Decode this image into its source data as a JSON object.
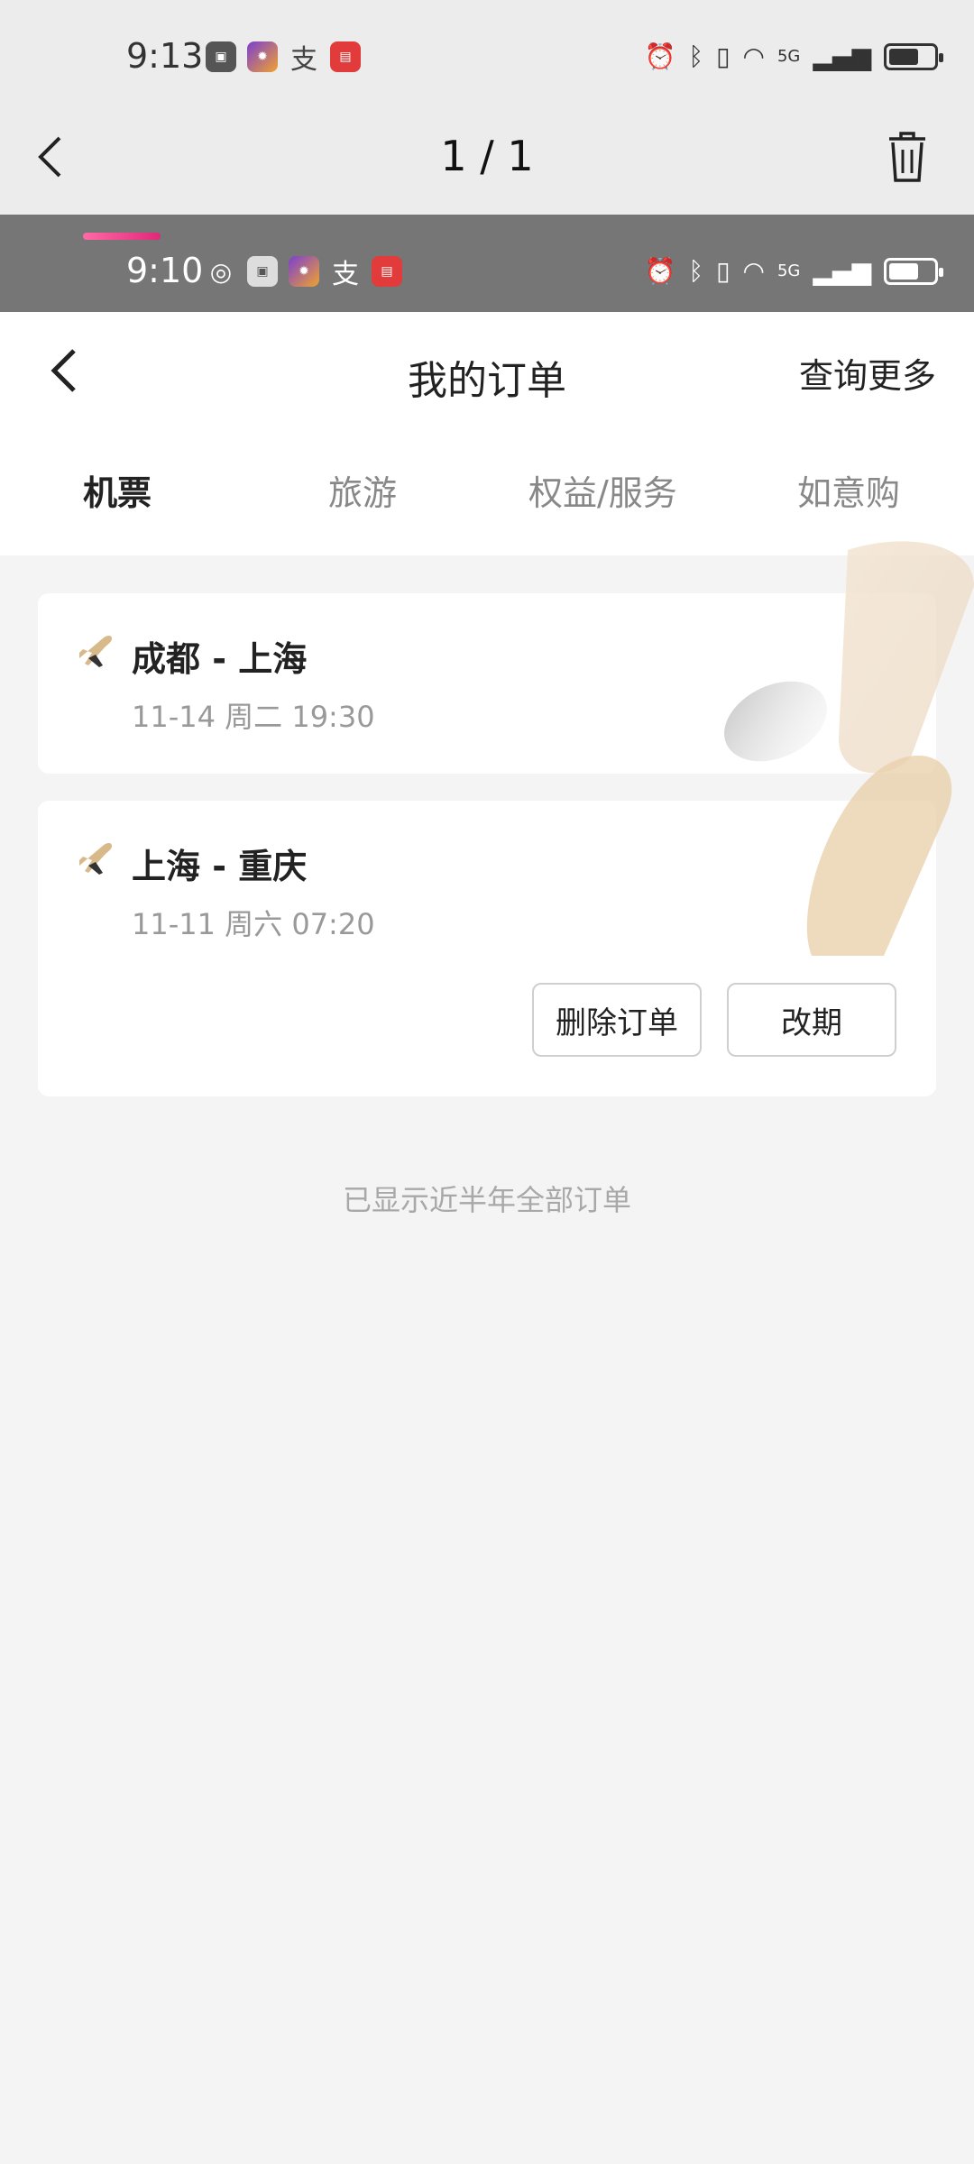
{
  "outer_status": {
    "time": "9:13",
    "network": "5G"
  },
  "viewer": {
    "back_glyph": "‹",
    "counter": "1 / 1"
  },
  "shot_status": {
    "time": "9:10",
    "network": "5G"
  },
  "header": {
    "back_glyph": "‹",
    "title": "我的订单",
    "more": "查询更多"
  },
  "tabs": [
    {
      "label": "机票",
      "active": true
    },
    {
      "label": "旅游",
      "active": false
    },
    {
      "label": "权益/服务",
      "active": false
    },
    {
      "label": "如意购",
      "active": false
    }
  ],
  "orders": [
    {
      "route": "成都 - 上海",
      "date": "11-14 周二 19:30"
    },
    {
      "route": "上海 - 重庆",
      "date": "11-11 周六 07:20",
      "buttons": [
        "删除订单",
        "改期"
      ]
    }
  ],
  "footer": "已显示近半年全部订单",
  "colors": {
    "accent": "#e0287a",
    "plane_icon": "#d8b98a"
  }
}
